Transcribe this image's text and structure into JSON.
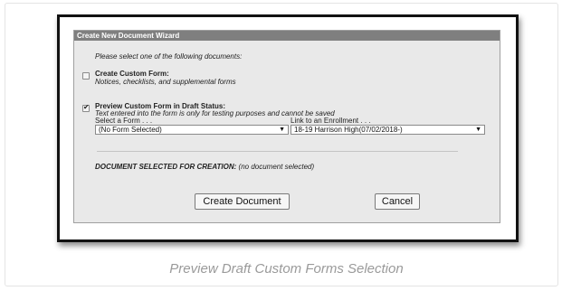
{
  "wizard": {
    "title": "Create New Document Wizard",
    "instructions": "Please select one of the following documents:",
    "option1": {
      "title": "Create Custom Form:",
      "description": "Notices, checklists, and supplemental forms",
      "checked": false
    },
    "option2": {
      "title": "Preview Custom Form in Draft Status:",
      "description": "Text entered into the form is only for testing purposes and cannot be saved",
      "checked": true,
      "checkmark": "✔"
    },
    "form_select": {
      "label": "Select a Form . . .",
      "value": "(No Form Selected)"
    },
    "enrollment_select": {
      "label": "Link to an Enrollment . . .",
      "value": "18-19 Harrison High(07/02/2018-)"
    },
    "select_arrow": "▼",
    "document_selected_label": "DOCUMENT SELECTED FOR CREATION:",
    "document_selected_value": "(no document selected)",
    "create_button": "Create Document",
    "cancel_button": "Cancel"
  },
  "caption": "Preview Draft Custom Forms Selection",
  "colors": {
    "title_bar": "#7f7f7f",
    "panel": "#e9e9e9",
    "caption": "#9a9a9a"
  }
}
